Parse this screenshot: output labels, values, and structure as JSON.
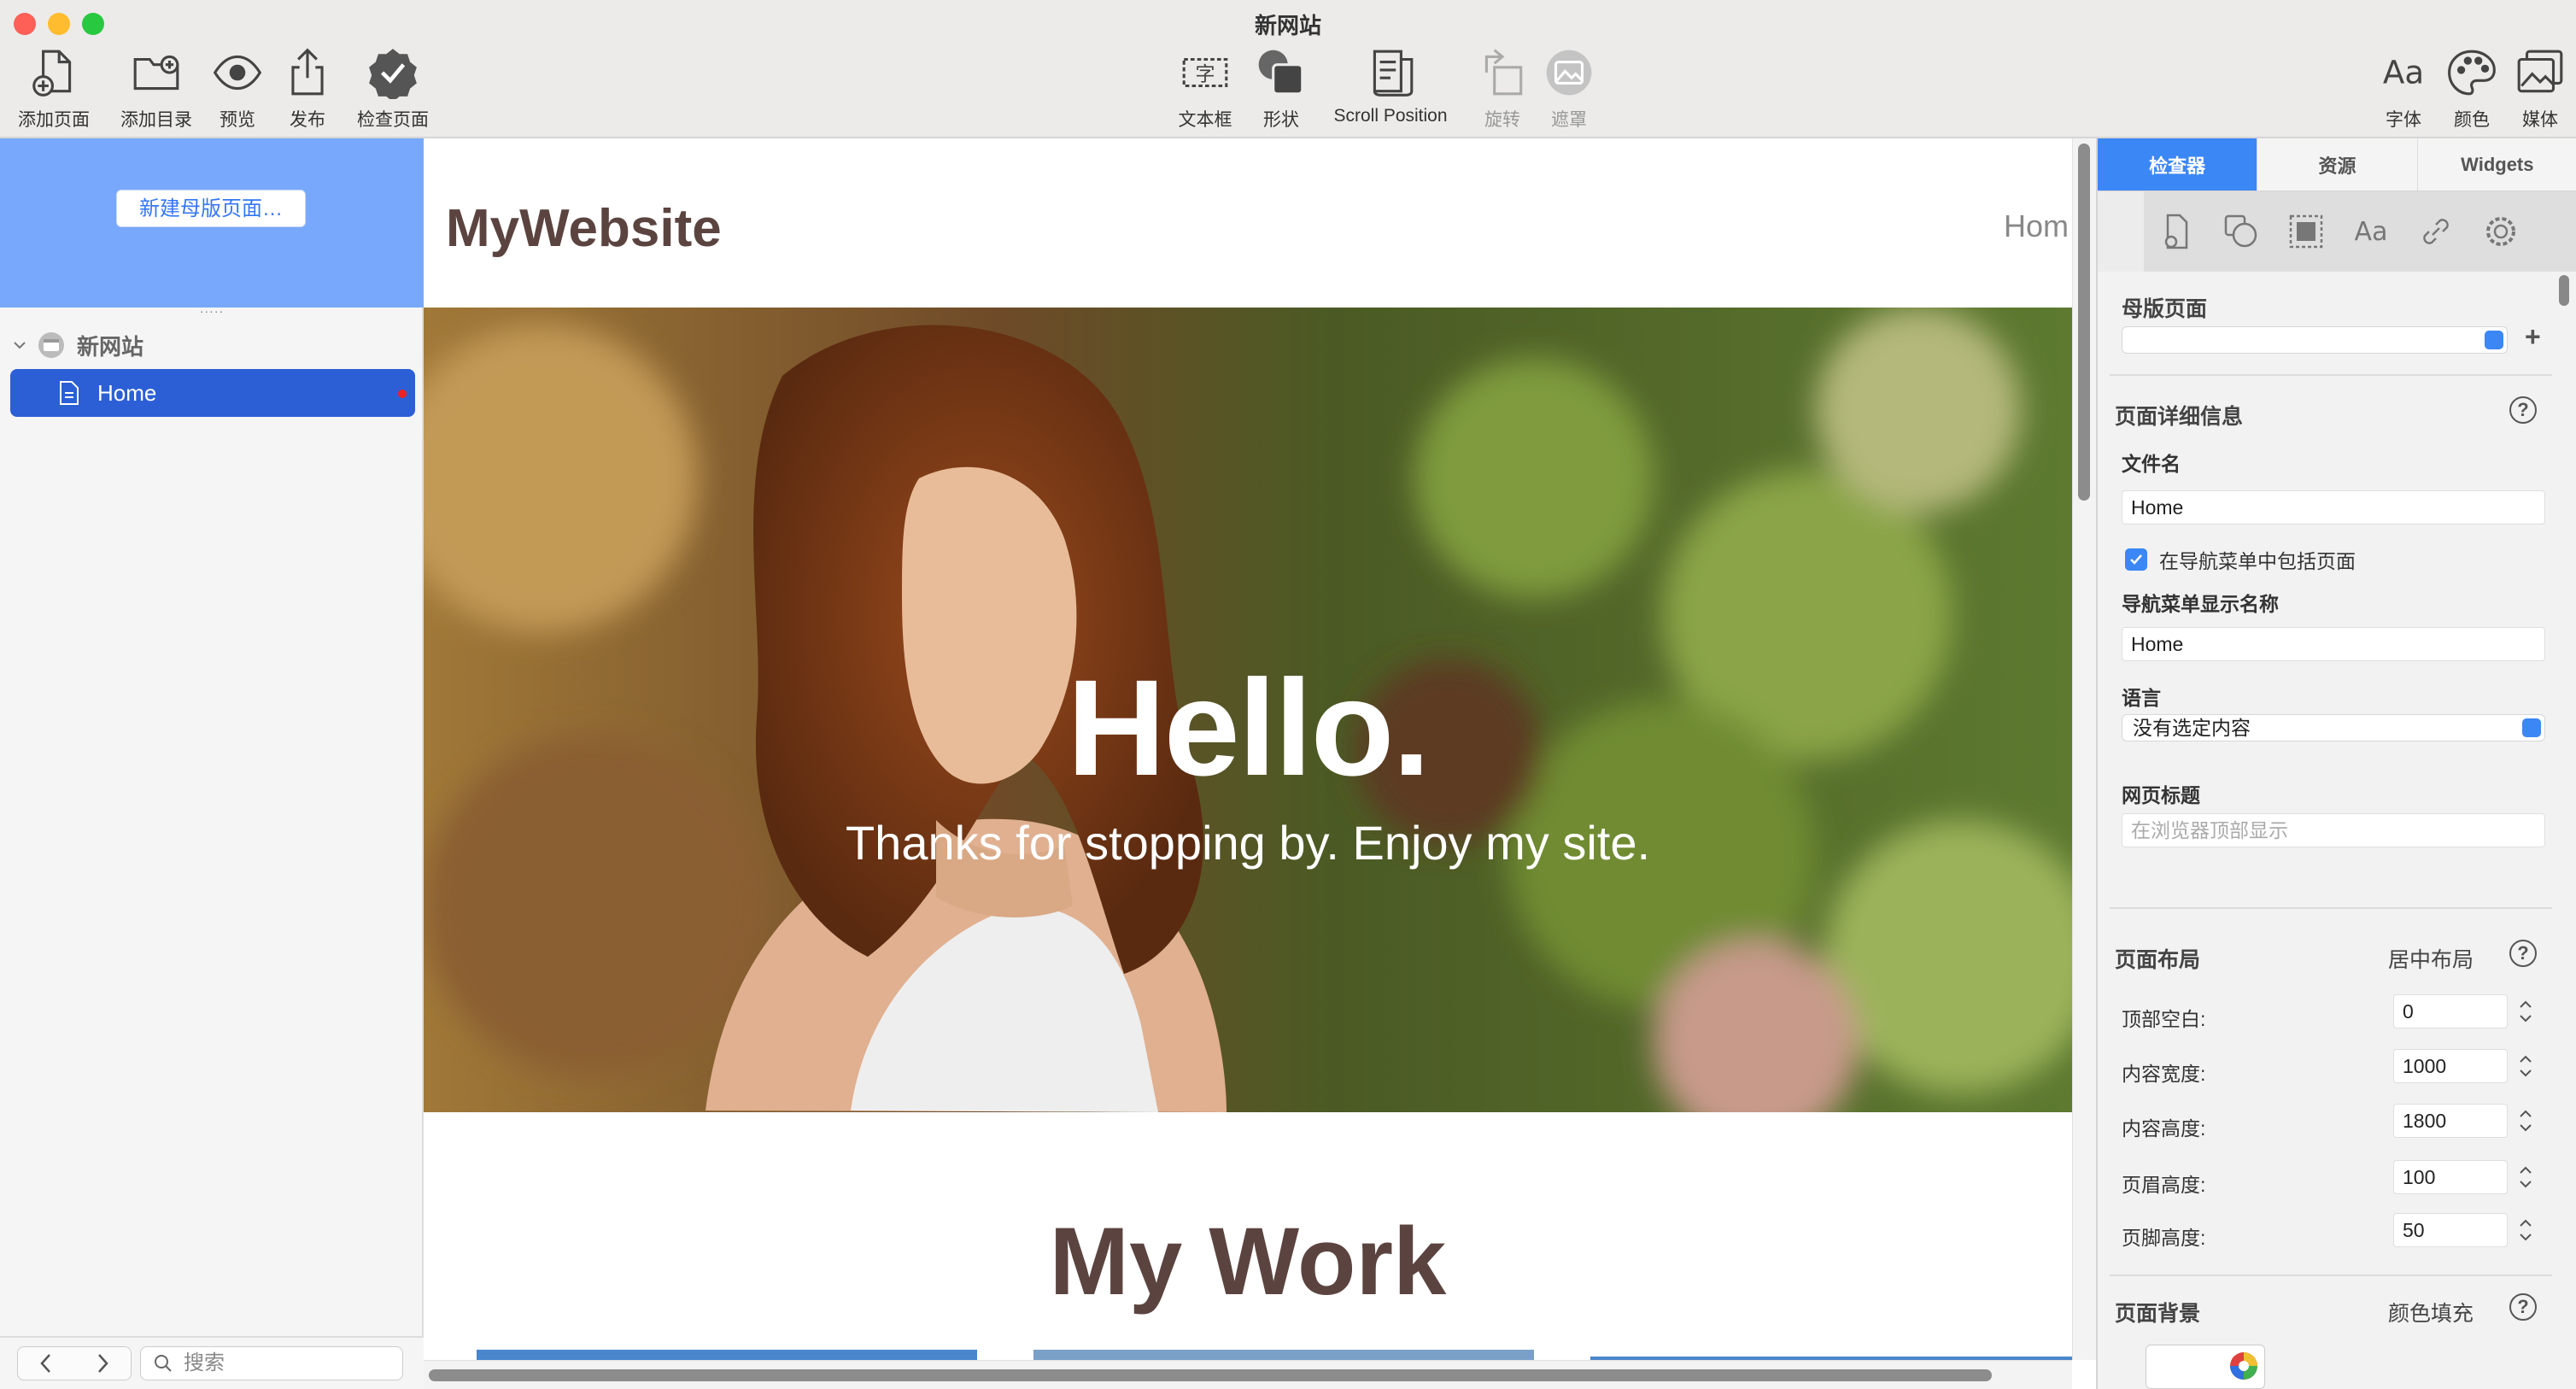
{
  "window": {
    "title": "新网站"
  },
  "toolbar": {
    "left": [
      {
        "label": "添加页面",
        "icon": "add-page-icon"
      },
      {
        "label": "添加目录",
        "icon": "add-folder-icon"
      },
      {
        "label": "预览",
        "icon": "eye-icon"
      },
      {
        "label": "发布",
        "icon": "share-icon"
      },
      {
        "label": "检查页面",
        "icon": "check-badge-icon"
      }
    ],
    "center": [
      {
        "label": "文本框",
        "icon": "text-box-icon"
      },
      {
        "label": "形状",
        "icon": "shape-icon"
      },
      {
        "label": "Scroll Position",
        "icon": "scroll-position-icon"
      },
      {
        "label": "旋转",
        "icon": "rotate-icon",
        "disabled": true
      },
      {
        "label": "遮罩",
        "icon": "mask-icon",
        "disabled": true
      }
    ],
    "right": [
      {
        "label": "字体",
        "icon": "font-icon"
      },
      {
        "label": "颜色",
        "icon": "palette-icon"
      },
      {
        "label": "媒体",
        "icon": "media-icon"
      }
    ]
  },
  "sidebar": {
    "new_master": "新建母版页面…",
    "site_name": "新网站",
    "page": "Home",
    "search_placeholder": "搜索"
  },
  "canvas": {
    "site_title": "MyWebsite",
    "nav_item": "Hom",
    "hero_title": "Hello.",
    "hero_subtitle": "Thanks for stopping by. Enjoy my site.",
    "work_title": "My Work"
  },
  "inspector": {
    "tabs": [
      "检查器",
      "资源",
      "Widgets"
    ],
    "active_tab": "检查器",
    "master_page_label": "母版页面",
    "add": "+",
    "page_details_label": "页面详细信息",
    "filename_label": "文件名",
    "filename_value": "Home",
    "include_nav_label": "在导航菜单中包括页面",
    "include_nav_checked": true,
    "nav_name_label": "导航菜单显示名称",
    "nav_name_value": "Home",
    "language_label": "语言",
    "language_value": "没有选定内容",
    "page_title_label": "网页标题",
    "page_title_placeholder": "在浏览器顶部显示",
    "layout_label": "页面布局",
    "layout_value": "居中布局",
    "layout_fields": [
      {
        "label": "顶部空白:",
        "value": "0"
      },
      {
        "label": "内容宽度:",
        "value": "1000"
      },
      {
        "label": "内容高度:",
        "value": "1800"
      },
      {
        "label": "页眉高度:",
        "value": "100"
      },
      {
        "label": "页脚高度:",
        "value": "50"
      }
    ],
    "background_label": "页面背景",
    "background_value": "颜色填充",
    "help": "?"
  },
  "colors": {
    "accent": "#3b87f5",
    "selection": "#2c5fd6",
    "master": "#78a8fb",
    "brand_text": "#5b4440"
  }
}
